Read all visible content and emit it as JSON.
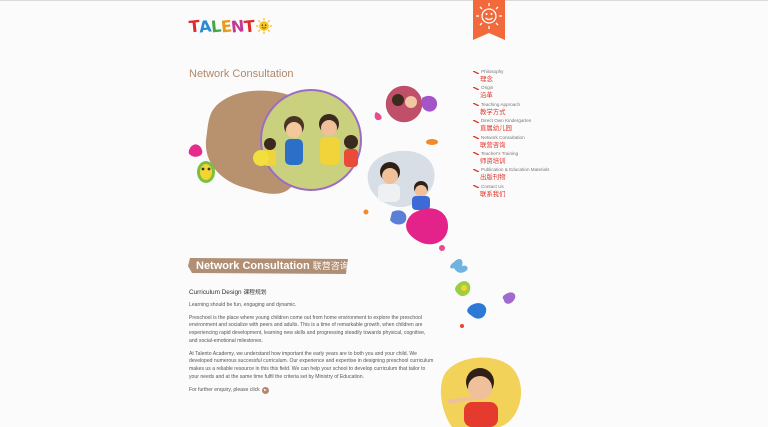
{
  "logo": {
    "text": "TALENT",
    "letters": [
      {
        "char": "T",
        "color": "#e0292a"
      },
      {
        "char": "A",
        "color": "#2a8ad6"
      },
      {
        "char": "L",
        "color": "#44a845"
      },
      {
        "char": "E",
        "color": "#e89a1c"
      },
      {
        "char": "N",
        "color": "#c13a93"
      },
      {
        "char": "T",
        "color": "#e0292a"
      }
    ],
    "sun_color": "#f6c21b"
  },
  "colors": {
    "brown_accent": "#b4876b",
    "banner_bg": "#b08f74",
    "chinese_red": "#e1352a",
    "ribbon": "#f26a3c"
  },
  "page": {
    "title": "Network Consultation"
  },
  "nav": {
    "items": [
      {
        "en": "Philosophy",
        "cn": "理念"
      },
      {
        "en": "Origin",
        "cn": "沿革"
      },
      {
        "en": "Teaching Approach",
        "cn": "教学方式"
      },
      {
        "en": "Direct Own Kindergarten",
        "cn": "直属幼儿园"
      },
      {
        "en": "Network Consultation",
        "cn": "联营咨询"
      },
      {
        "en": "Teacher's Training",
        "cn": "师资培训"
      },
      {
        "en": "Publication & Education Materials",
        "cn": "出版刊物"
      },
      {
        "en": "Contact Us",
        "cn": "联系我们"
      }
    ]
  },
  "banner": {
    "en": "Network Consultation",
    "cn": "联营咨询"
  },
  "content": {
    "heading_en": "Curriculum Design",
    "heading_cn": "课程规划",
    "tagline": "Learning should be fun, engaging and dynamic.",
    "p1": "Preschool is the place where young children come out from home environment to explore the preschool environment and socialize with peers and adults. This is a time of remarkable growth, when children are experiencing rapid development, learning new skills and progressing steadily towards physical, cognitive, and social-emotional milestones.",
    "p2": "At Talento Academy, we understand how important the early years are to both you and your child. We developed numerous successful curriculum. Our experience and expertise in designing preschool curriculum makes us a reliable resource in this this field. We can help your school to develop curriculum that tailor to your needs and at the same time fulfil the criteria set by Ministry of Education.",
    "enquiry": "For further enquiry, please click"
  }
}
